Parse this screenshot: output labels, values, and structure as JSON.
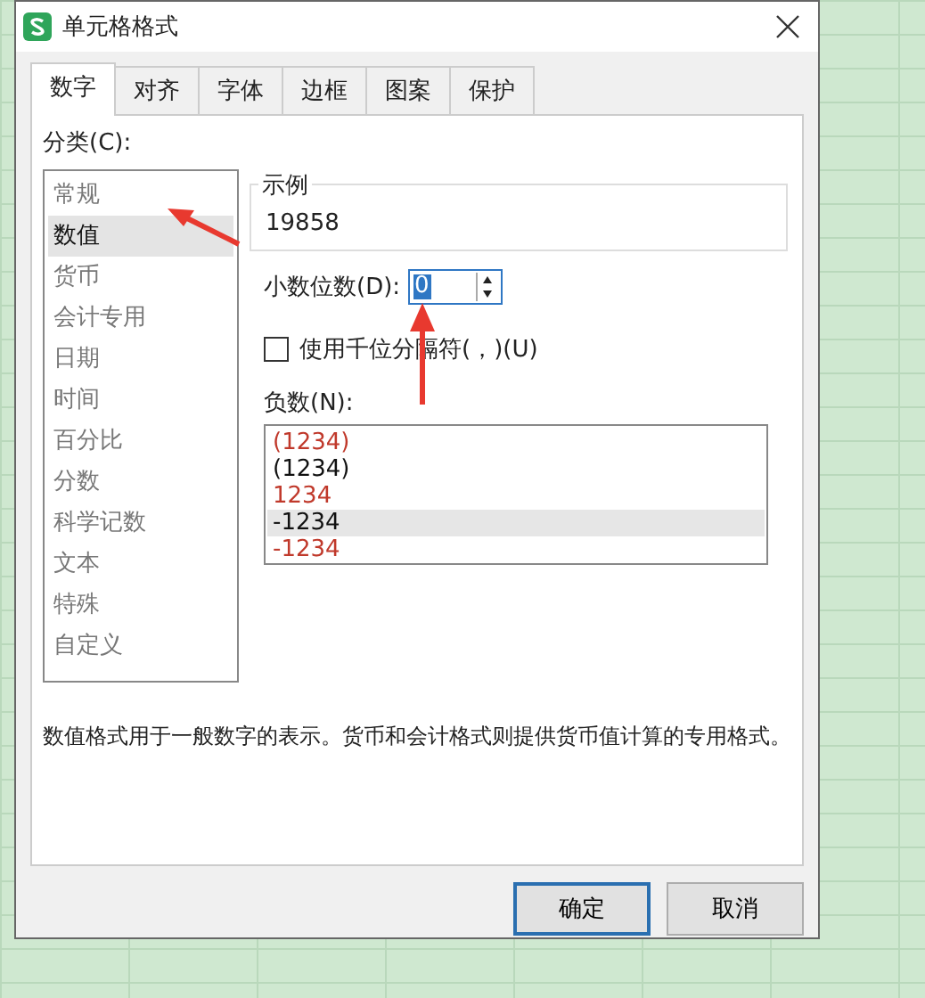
{
  "window": {
    "title": "单元格格式"
  },
  "tabs": [
    {
      "label": "数字",
      "selected": true
    },
    {
      "label": "对齐",
      "selected": false
    },
    {
      "label": "字体",
      "selected": false
    },
    {
      "label": "边框",
      "selected": false
    },
    {
      "label": "图案",
      "selected": false
    },
    {
      "label": "保护",
      "selected": false
    }
  ],
  "category": {
    "label": "分类(C):",
    "items": [
      {
        "label": "常规",
        "selected": false
      },
      {
        "label": "数值",
        "selected": true
      },
      {
        "label": "货币",
        "selected": false
      },
      {
        "label": "会计专用",
        "selected": false
      },
      {
        "label": "日期",
        "selected": false
      },
      {
        "label": "时间",
        "selected": false
      },
      {
        "label": "百分比",
        "selected": false
      },
      {
        "label": "分数",
        "selected": false
      },
      {
        "label": "科学记数",
        "selected": false
      },
      {
        "label": "文本",
        "selected": false
      },
      {
        "label": "特殊",
        "selected": false
      },
      {
        "label": "自定义",
        "selected": false
      }
    ]
  },
  "sample": {
    "title": "示例",
    "value": "19858"
  },
  "decimal_places": {
    "label": "小数位数(D):",
    "value": "0"
  },
  "thousands_separator": {
    "label": "使用千位分隔符(，)(U)",
    "checked": false
  },
  "negative_numbers": {
    "label": "负数(N):",
    "items": [
      {
        "text": "(1234)",
        "color": "#c0392b",
        "selected": false
      },
      {
        "text": "(1234)",
        "color": "#111111",
        "selected": false
      },
      {
        "text": "1234",
        "color": "#c0392b",
        "selected": false
      },
      {
        "text": "-1234",
        "color": "#111111",
        "selected": true
      },
      {
        "text": "-1234",
        "color": "#c0392b",
        "selected": false
      }
    ]
  },
  "description": "数值格式用于一般数字的表示。货币和会计格式则提供货币值计算的专用格式。",
  "buttons": [
    {
      "label": "确定",
      "kind": "primary"
    },
    {
      "label": "取消",
      "kind": "normal"
    }
  ]
}
